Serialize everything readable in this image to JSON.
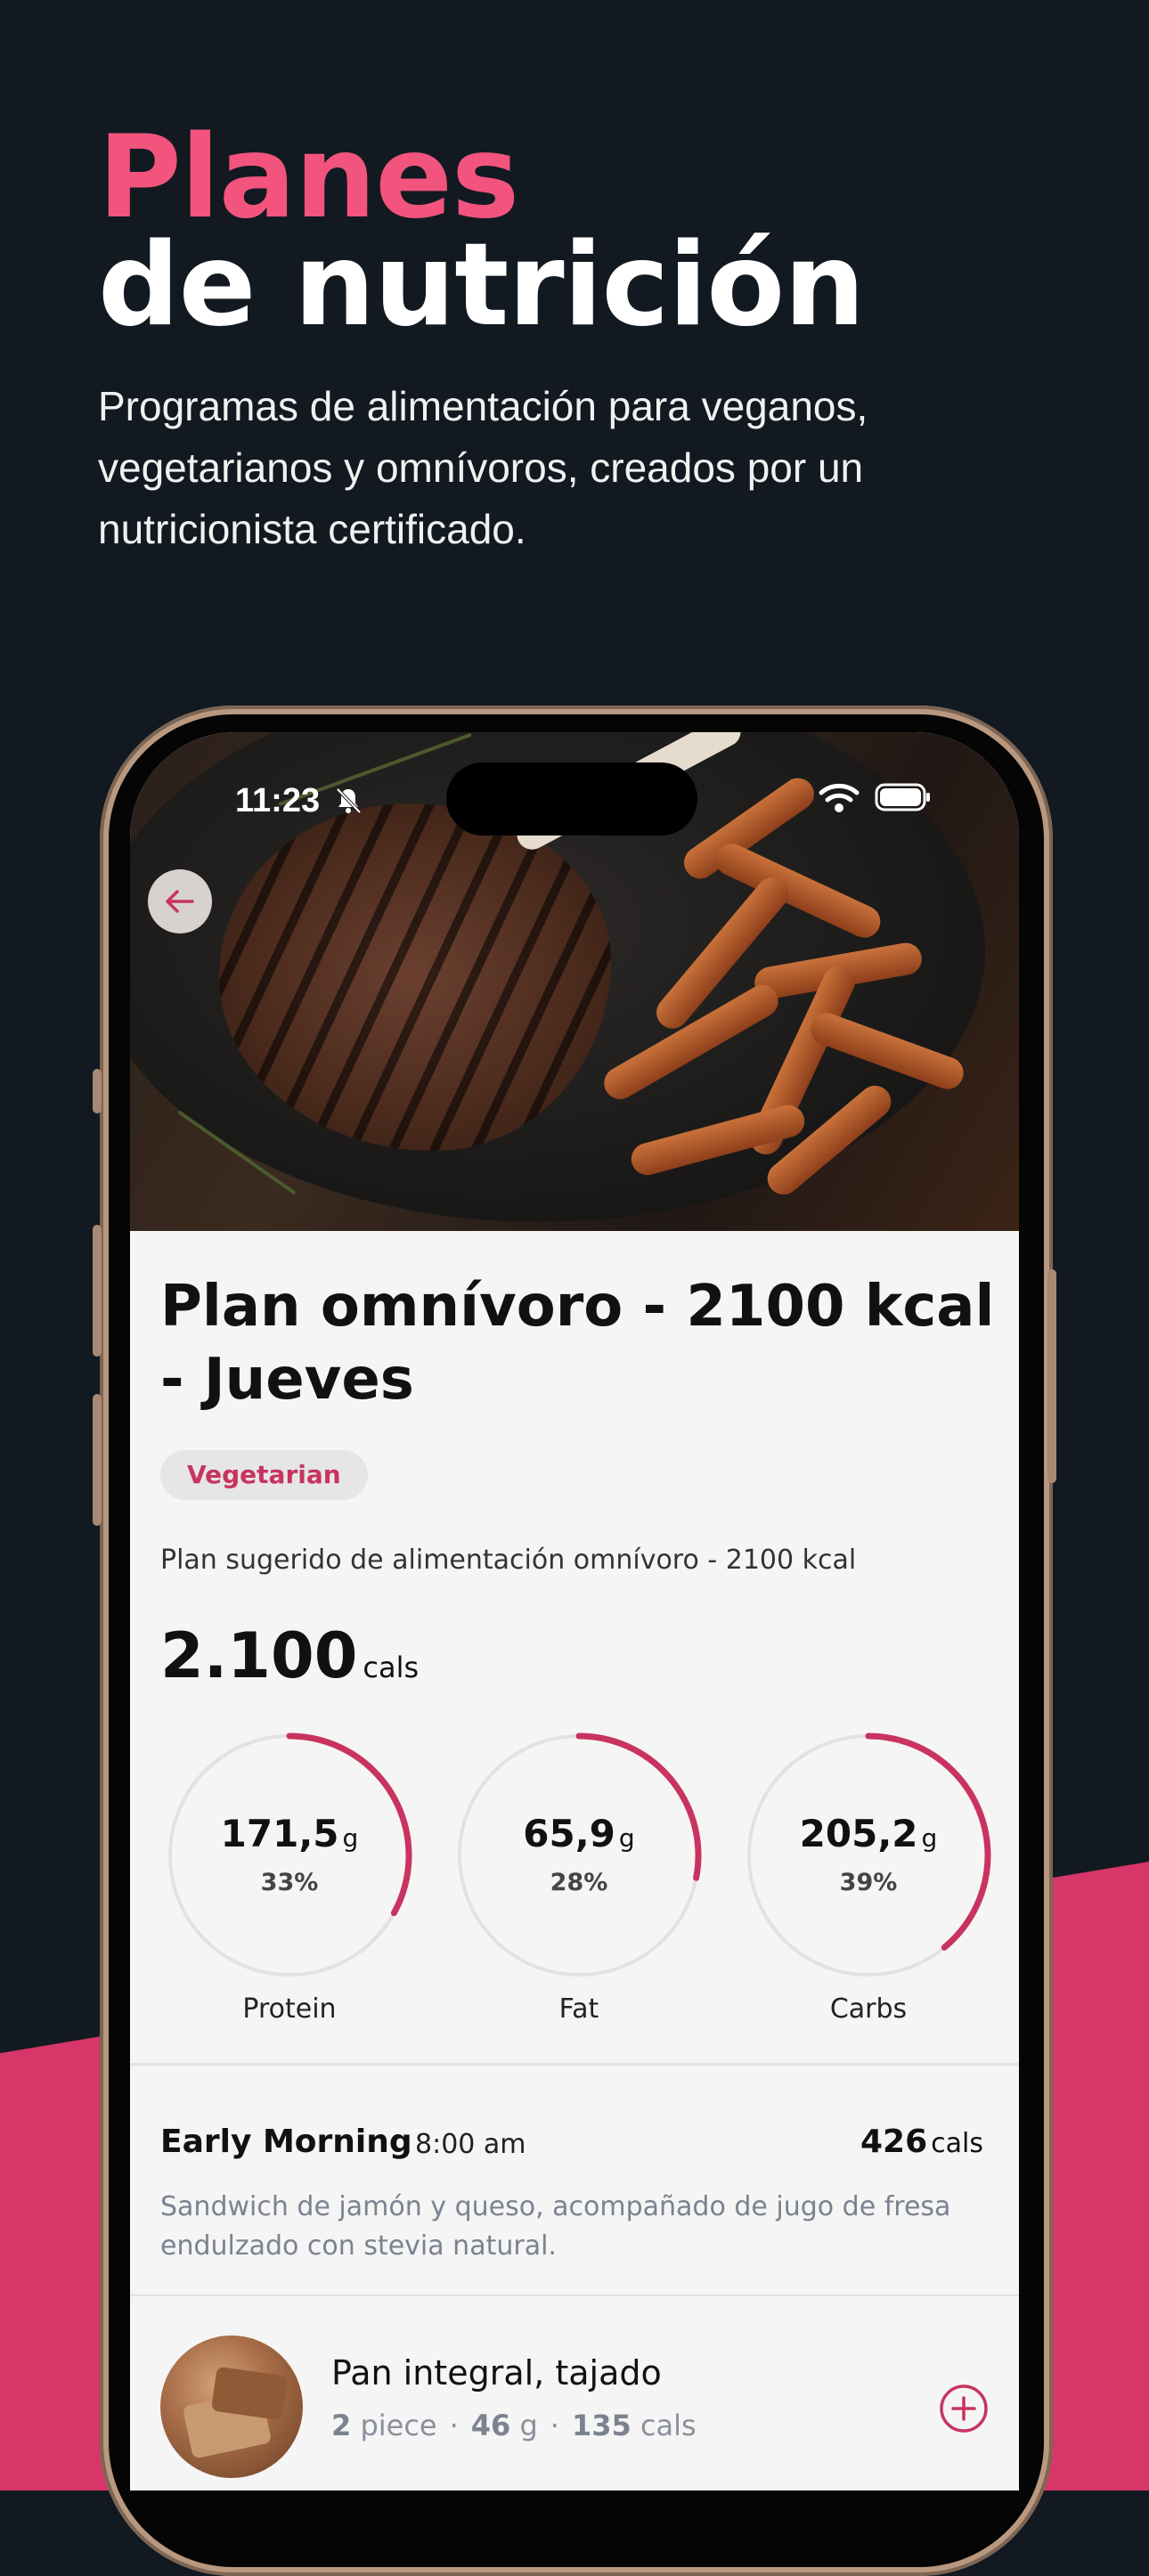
{
  "hero": {
    "title_line1": "Planes",
    "title_line2": "de nutrición",
    "subtitle": "Programas de alimentación para veganos, vegetarianos y omnívoros, creados por un nutricionista certificado."
  },
  "status_bar": {
    "time": "11:23"
  },
  "plan": {
    "title": "Plan omnívoro - 2100 kcal - Jueves",
    "tag": "Vegetarian",
    "description": "Plan sugerido de alimentación omnívoro - 2100 kcal",
    "total_calories": "2.100",
    "total_unit": "cals",
    "macros": [
      {
        "label": "Protein",
        "value": "171,5",
        "unit": "g",
        "percent": "33%",
        "fraction": 0.33
      },
      {
        "label": "Fat",
        "value": "65,9",
        "unit": "g",
        "percent": "28%",
        "fraction": 0.28
      },
      {
        "label": "Carbs",
        "value": "205,2",
        "unit": "g",
        "percent": "39%",
        "fraction": 0.39
      }
    ]
  },
  "meal": {
    "name": "Early Morning",
    "time": "8:00 am",
    "calories": "426",
    "calories_unit": "cals",
    "description": "Sandwich de jamón y queso, acompañado de jugo de fresa endulzado con stevia natural."
  },
  "food_item": {
    "name": "Pan integral, tajado",
    "quantity": "2",
    "quantity_unit": "piece",
    "weight": "46",
    "weight_unit": "g",
    "calories": "135",
    "calories_unit": "cals"
  },
  "colors": {
    "background": "#121921",
    "accent": "#d63668",
    "title_accent": "#f2547d",
    "ring": "#c8345f"
  }
}
